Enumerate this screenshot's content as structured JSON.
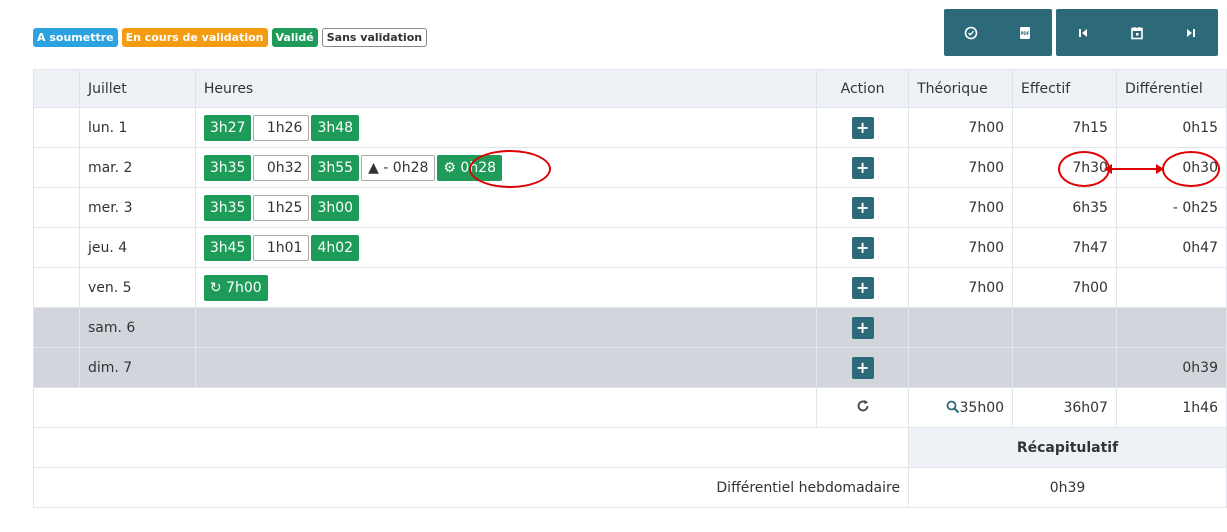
{
  "legend": {
    "a_soumettre": "A soumettre",
    "en_cours": "En cours de validation",
    "valide": "Validé",
    "sans_validation": "Sans validation"
  },
  "toolbar": {
    "icons": [
      "clock-icon",
      "pdf-icon",
      "first-icon",
      "calendar-icon",
      "next-icon"
    ]
  },
  "table": {
    "headers": [
      "Juillet",
      "Heures",
      "Action",
      "Théorique",
      "Effectif",
      "Différentiel"
    ],
    "rows": [
      {
        "day": "lun. 1",
        "chips": [
          {
            "t": "3h27",
            "k": "g"
          },
          {
            "t": "1h26",
            "k": "w"
          },
          {
            "t": "3h48",
            "k": "g"
          }
        ],
        "theo": "7h00",
        "eff": "7h15",
        "diff": "0h15"
      },
      {
        "day": "mar. 2",
        "chips": [
          {
            "t": "3h35",
            "k": "g"
          },
          {
            "t": "0h32",
            "k": "w"
          },
          {
            "t": "3h55",
            "k": "g"
          },
          {
            "t": "▲ - 0h28",
            "k": "w"
          },
          {
            "t": "⚙ 0h28",
            "k": "g"
          }
        ],
        "theo": "7h00",
        "eff": "7h30",
        "diff": "0h30"
      },
      {
        "day": "mer. 3",
        "chips": [
          {
            "t": "3h35",
            "k": "g"
          },
          {
            "t": "1h25",
            "k": "w"
          },
          {
            "t": "3h00",
            "k": "g"
          }
        ],
        "theo": "7h00",
        "eff": "6h35",
        "diff": "- 0h25"
      },
      {
        "day": "jeu. 4",
        "chips": [
          {
            "t": "3h45",
            "k": "g"
          },
          {
            "t": "1h01",
            "k": "w"
          },
          {
            "t": "4h02",
            "k": "g"
          }
        ],
        "theo": "7h00",
        "eff": "7h47",
        "diff": "0h47"
      },
      {
        "day": "ven. 5",
        "chips": [
          {
            "t": "↻ 7h00",
            "k": "g"
          }
        ],
        "theo": "7h00",
        "eff": "7h00",
        "diff": ""
      },
      {
        "day": "sam. 6",
        "chips": [],
        "theo": "",
        "eff": "",
        "diff": ""
      },
      {
        "day": "dim. 7",
        "chips": [],
        "theo": "",
        "eff": "",
        "diff": "0h39"
      }
    ],
    "totals": {
      "theo": "35h00",
      "eff": "36h07",
      "diff": "1h46"
    },
    "recap_title": "Récapitulatif",
    "weekly_label": "Différentiel hebdomadaire",
    "weekly_value": "0h39"
  },
  "colors": {
    "accent": "#2c6a7a",
    "valid_green": "#1e9b58",
    "annotation_red": "#e00000"
  }
}
